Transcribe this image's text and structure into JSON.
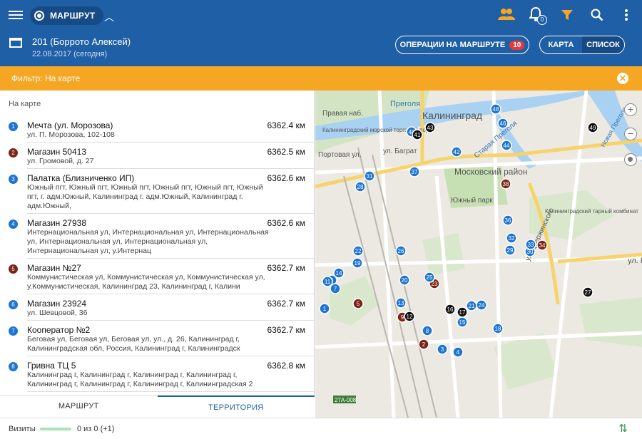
{
  "header": {
    "route_chip": "МАРШРУТ",
    "route_title": "201 (Боррото Алексей)",
    "route_date": "22.08.2017 (сегодня)",
    "notif_count": "0",
    "ops_label": "ОПЕРАЦИИ НА МАРШРУТЕ",
    "ops_count": "10",
    "view_map": "КАРТА",
    "view_list": "СПИСОК",
    "colors": {
      "primary": "#1f5fa6",
      "accent": "#f5a623",
      "badge": "#e23a3a"
    }
  },
  "filter": {
    "label": "Фильтр: На карте"
  },
  "list": {
    "section": "На карте",
    "items": [
      {
        "num": "1",
        "color": "#1e74d2",
        "name": "Мечта (ул. Морозова)",
        "addr": "ул. П. Морозова, 102-108",
        "dist": "6362.4 км"
      },
      {
        "num": "2",
        "color": "#7b2517",
        "name": "Магазин 50413",
        "addr": "ул. Громовой, д. 27",
        "dist": "6362.5 км"
      },
      {
        "num": "3",
        "color": "#1e74d2",
        "name": "Палатка (Близниченко ИП)",
        "addr": "Южный пгт, Южный пгт, Южный пгт, Южный пгт, Южный пгт, Южный пгт, г. адм.Южный, Калининград г. адм.Южный, Калининград г. адм.Южный,",
        "dist": "6362.6 км"
      },
      {
        "num": "4",
        "color": "#1e74d2",
        "name": "Магазин 27938",
        "addr": "Интернациональная ул, Интернациональная ул, Интернациональная ул, Интернациональная ул, Интернациональная ул, Интернациональная ул, у.Интернац",
        "dist": "6362.6 км"
      },
      {
        "num": "5",
        "color": "#7b2517",
        "name": "Магазин №27",
        "addr": "Коммунистическая ул, Коммунистическая ул, Коммунистическая ул, у.Коммунистическая, Калининград 23, Калининград г, Калини",
        "dist": "6362.7 км"
      },
      {
        "num": "6",
        "color": "#1e74d2",
        "name": "Магазин 23924",
        "addr": "ул. Шевцовой, 36",
        "dist": "6362.7 км"
      },
      {
        "num": "7",
        "color": "#1e74d2",
        "name": "Кооператор №2",
        "addr": "Беговая ул, Беговая ул, Беговая ул, ул., д. 26, Калининград г, Калининградская обл, Россия, Калининград г, Калининградск",
        "dist": "6362.7 км"
      },
      {
        "num": "8",
        "color": "#1e74d2",
        "name": "Гривна ТЦ 5",
        "addr": "Калининград г, Калининград г, Калининград г, Калининград г, Калининград г, Калининград г, Калининград г, Калининградская 2",
        "dist": "6362.8 км"
      }
    ]
  },
  "tabs": {
    "route": "МАРШРУТ",
    "territory": "ТЕРРИТОРИЯ"
  },
  "map": {
    "labels": {
      "city": "Калининград",
      "district": "Московский район",
      "park": "Южный парк",
      "river": "Преголя",
      "river2": "Старая Преголя",
      "embankment": "Правая наб.",
      "street1": "ул. Баграт",
      "street2": "Портовая ул.",
      "street3": "ул. Дзержинского",
      "street4": "Новая Преголя",
      "street5": "ул. Г",
      "plant": "Калининградский тарный комбинат",
      "port": "Калининградский морской торговый порт",
      "road": "27А-008"
    },
    "markers": [
      {
        "n": "1",
        "c": "blue"
      },
      {
        "n": "2",
        "c": "brown"
      },
      {
        "n": "3",
        "c": "blue"
      },
      {
        "n": "4",
        "c": "blue"
      },
      {
        "n": "5",
        "c": "brown"
      },
      {
        "n": "6",
        "c": "blue"
      },
      {
        "n": "7",
        "c": "blue"
      },
      {
        "n": "8",
        "c": "blue"
      },
      {
        "n": "9",
        "c": "brown"
      },
      {
        "n": "11",
        "c": "blue"
      },
      {
        "n": "12",
        "c": "black"
      },
      {
        "n": "13",
        "c": "blue"
      },
      {
        "n": "14",
        "c": "blue"
      },
      {
        "n": "15",
        "c": "blue"
      },
      {
        "n": "16",
        "c": "black"
      },
      {
        "n": "17",
        "c": "black"
      },
      {
        "n": "18",
        "c": "blue"
      },
      {
        "n": "19",
        "c": "blue"
      },
      {
        "n": "20",
        "c": "blue"
      },
      {
        "n": "21",
        "c": "blue"
      },
      {
        "n": "22",
        "c": "blue"
      },
      {
        "n": "23",
        "c": "brown"
      },
      {
        "n": "24",
        "c": "blue"
      },
      {
        "n": "25",
        "c": "blue"
      },
      {
        "n": "26",
        "c": "blue"
      },
      {
        "n": "27",
        "c": "black"
      },
      {
        "n": "28",
        "c": "blue"
      },
      {
        "n": "29",
        "c": "blue"
      },
      {
        "n": "30",
        "c": "blue"
      },
      {
        "n": "31",
        "c": "blue"
      },
      {
        "n": "32",
        "c": "blue"
      },
      {
        "n": "33",
        "c": "blue"
      },
      {
        "n": "34",
        "c": "brown"
      },
      {
        "n": "36",
        "c": "blue"
      },
      {
        "n": "37",
        "c": "blue"
      },
      {
        "n": "38",
        "c": "brown"
      },
      {
        "n": "40",
        "c": "blue"
      },
      {
        "n": "41",
        "c": "black"
      },
      {
        "n": "42",
        "c": "blue"
      },
      {
        "n": "43",
        "c": "black"
      },
      {
        "n": "44",
        "c": "blue"
      },
      {
        "n": "46",
        "c": "blue"
      },
      {
        "n": "48",
        "c": "blue"
      },
      {
        "n": "49",
        "c": "black"
      }
    ]
  },
  "footer": {
    "label": "Визиты",
    "value": "0 из 0 (+1)"
  }
}
